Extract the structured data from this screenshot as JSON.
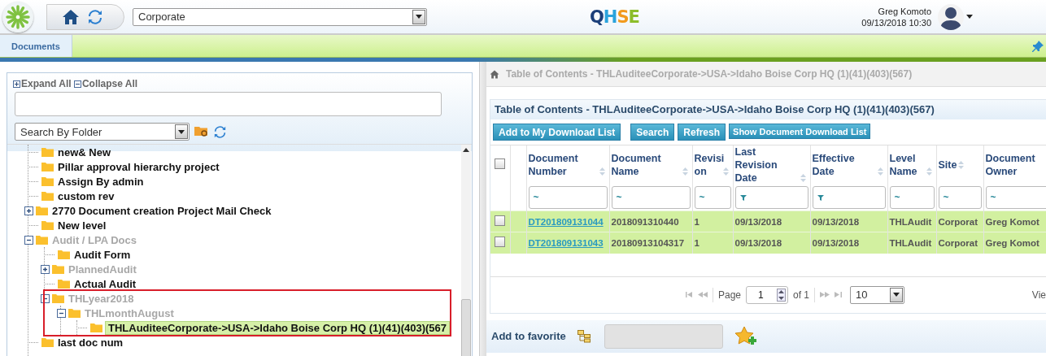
{
  "header": {
    "company": "Corporate",
    "logo_text": "QHSE",
    "user": "Greg Komoto",
    "datetime": "09/13/2018 10:30"
  },
  "tabs": [
    {
      "label": "Documents",
      "selected": true
    }
  ],
  "tree_panel": {
    "expand_all": "Expand All",
    "collapse_all": "Collapse All",
    "search_by": "Search By Folder",
    "nodes": [
      {
        "label": "new& New",
        "greyed": false,
        "selected": false
      },
      {
        "label": "Pillar approval hierarchy project",
        "greyed": false,
        "selected": false
      },
      {
        "label": "Assign By admin",
        "greyed": false,
        "selected": false
      },
      {
        "label": "custom rev",
        "greyed": false,
        "selected": false
      },
      {
        "label": "2770 Document creation Project Mail Check",
        "greyed": false,
        "selected": false,
        "expanded": false
      },
      {
        "label": "New level",
        "greyed": false,
        "selected": false
      },
      {
        "label": "Audit / LPA Docs",
        "greyed": true,
        "selected": false,
        "expanded": true,
        "children": [
          {
            "label": "Audit Form",
            "greyed": false,
            "selected": false
          },
          {
            "label": "PlannedAudit",
            "greyed": true,
            "selected": false,
            "expanded": false
          },
          {
            "label": "Actual Audit",
            "greyed": false,
            "selected": false
          },
          {
            "label": "THLyear2018",
            "greyed": true,
            "selected": false,
            "expanded": true,
            "highlighted": true,
            "children": [
              {
                "label": "THLmonthAugust",
                "greyed": true,
                "selected": false,
                "expanded": true,
                "children": [
                  {
                    "label": "THLAuditeeCorporate->USA->Idaho Boise Corp HQ (1)(41)(403)(567",
                    "greyed": false,
                    "selected": true
                  }
                ]
              }
            ]
          }
        ]
      },
      {
        "label": "last doc num",
        "greyed": false,
        "selected": false
      }
    ]
  },
  "content": {
    "breadcrumb": "Table of Contents - THLAuditeeCorporate->USA->Idaho Boise Corp HQ (1)(41)(403)(567)",
    "title": "Table of Contents - THLAuditeeCorporate->USA->Idaho Boise Corp HQ (1)(41)(403)(567)",
    "buttons": [
      "Add to My Download List",
      "Search",
      "Refresh",
      "Show Document Download List"
    ],
    "table": {
      "columns": [
        {
          "label": "Document Number",
          "filter": {
            "kind": "text",
            "symbol": "~"
          }
        },
        {
          "label": "Document Name",
          "filter": {
            "kind": "text",
            "symbol": "~"
          }
        },
        {
          "label": "Revisi on",
          "filter": {
            "kind": "text",
            "symbol": "~"
          }
        },
        {
          "label": "Last Revision Date",
          "filter": {
            "kind": "date"
          }
        },
        {
          "label": "Effective Date",
          "filter": {
            "kind": "date"
          }
        },
        {
          "label": "Level Name",
          "filter": {
            "kind": "text",
            "symbol": "~"
          }
        },
        {
          "label": "Site",
          "filter": {
            "kind": "text",
            "symbol": "~"
          }
        },
        {
          "label": "Document Owner",
          "filter": {
            "kind": "text",
            "symbol": "~"
          }
        }
      ],
      "select_all_checked": false,
      "rows": [
        {
          "checked": false,
          "selected": true,
          "cells": [
            "DT201809131044",
            "2018091310440",
            "1",
            "09/13/2018",
            "09/13/2018",
            "THLAudit",
            "Corporat",
            "Greg Komot"
          ]
        },
        {
          "checked": false,
          "selected": true,
          "cells": [
            "DT201809131043",
            "20180913104317",
            "1",
            "09/13/2018",
            "09/13/2018",
            "THLAudit",
            "Corporat",
            "Greg Komot"
          ]
        }
      ]
    },
    "pager": {
      "page_label": "Page",
      "page": "1",
      "of": "of 1",
      "page_size": "10",
      "view": "Vie"
    },
    "favorite": {
      "label": "Add to favorite"
    }
  }
}
